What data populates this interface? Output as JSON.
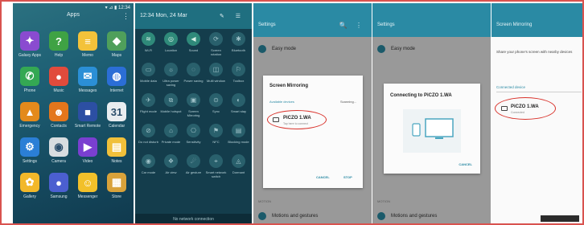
{
  "panel1": {
    "status_right": "▾ ⊿ ▮ 12:34",
    "title": "Apps",
    "more_icon": "⋮",
    "apps": [
      {
        "label": "Galaxy Apps",
        "color": "#8a4bd0",
        "glyph": "✦"
      },
      {
        "label": "Help",
        "color": "#3fa244",
        "glyph": "?"
      },
      {
        "label": "Memo",
        "color": "#f3c23a",
        "glyph": "≡"
      },
      {
        "label": "Maps",
        "color": "#4f9f5b",
        "glyph": "◆"
      },
      {
        "label": "Phone",
        "color": "#34a853",
        "glyph": "✆"
      },
      {
        "label": "Music",
        "color": "#e14b3c",
        "glyph": "●"
      },
      {
        "label": "Messages",
        "color": "#2b8fd6",
        "glyph": "✉"
      },
      {
        "label": "Internet",
        "color": "#2b6ed6",
        "glyph": "◍"
      },
      {
        "label": "Emergency",
        "color": "#e38a1c",
        "glyph": "▲"
      },
      {
        "label": "Contacts",
        "color": "#e3761c",
        "glyph": "☻"
      },
      {
        "label": "Smart Remote",
        "color": "#2c4fa3",
        "glyph": "■"
      },
      {
        "label": "Calendar",
        "color": "#e9edf0",
        "glyph": "31"
      },
      {
        "label": "Settings",
        "color": "#2b7fd6",
        "glyph": "⚙"
      },
      {
        "label": "Camera",
        "color": "#d8dde0",
        "glyph": "◉"
      },
      {
        "label": "Video",
        "color": "#7a3fd0",
        "glyph": "▶"
      },
      {
        "label": "Notes",
        "color": "#f0c03a",
        "glyph": "▤"
      },
      {
        "label": "Gallery",
        "color": "#f2b82a",
        "glyph": "✿"
      },
      {
        "label": "Samsung",
        "color": "#4b5fd0",
        "glyph": "●"
      },
      {
        "label": "Messenger",
        "color": "#f2c02a",
        "glyph": "☺"
      },
      {
        "label": "Store",
        "color": "#d9a23a",
        "glyph": "▦"
      }
    ]
  },
  "panel2": {
    "time": "12:34 Mon, 24 Mar",
    "header_icons": "✎ ☰",
    "tiles": [
      {
        "glyph": "≋",
        "label": "Wi-Fi",
        "on": true
      },
      {
        "glyph": "◎",
        "label": "Location",
        "on": true
      },
      {
        "glyph": "◀",
        "label": "Sound",
        "on": true
      },
      {
        "glyph": "⟳",
        "label": "Screen rotation",
        "on": false
      },
      {
        "glyph": "✱",
        "label": "Bluetooth",
        "on": false
      },
      {
        "glyph": "▭",
        "label": "Mobile data",
        "on": false
      },
      {
        "glyph": "☼",
        "label": "Ultra power saving",
        "on": false
      },
      {
        "glyph": "◌",
        "label": "Power saving",
        "on": false
      },
      {
        "glyph": "◫",
        "label": "Multi window",
        "on": false
      },
      {
        "glyph": "⚐",
        "label": "Toolbox",
        "on": false
      },
      {
        "glyph": "✈",
        "label": "Flight mode",
        "on": false
      },
      {
        "glyph": "⧉",
        "label": "Mobile hotspot",
        "on": false
      },
      {
        "glyph": "▣",
        "label": "Screen Mirroring",
        "on": false
      },
      {
        "glyph": "⊙",
        "label": "Sync",
        "on": false
      },
      {
        "glyph": "◐",
        "label": "Smart stay",
        "on": false
      },
      {
        "glyph": "⊘",
        "label": "Do not disturb",
        "on": false
      },
      {
        "glyph": "⌂",
        "label": "Private mode",
        "on": false
      },
      {
        "glyph": "⎔",
        "label": "Sensitivity",
        "on": false
      },
      {
        "glyph": "⚑",
        "label": "NFC",
        "on": false
      },
      {
        "glyph": "▤",
        "label": "Blocking mode",
        "on": false
      },
      {
        "glyph": "◉",
        "label": "Car mode",
        "on": false
      },
      {
        "glyph": "❖",
        "label": "Air view",
        "on": false
      },
      {
        "glyph": "☄",
        "label": "Air gesture",
        "on": false
      },
      {
        "glyph": "⌖",
        "label": "Smart network switch",
        "on": false
      },
      {
        "glyph": "◬",
        "label": "Dormant",
        "on": false
      }
    ],
    "footer": "No network connection"
  },
  "panel3": {
    "title": "Settings",
    "icons": "🔍 ⋮",
    "row_top": "Easy mode",
    "section": "MOTION",
    "row_bottom": "Motions and gestures",
    "dialog": {
      "title": "Screen Mirroring",
      "available": "Available devices",
      "scanning": "Scanning...",
      "device_name": "PiCZO 1.WA",
      "device_sub": "Tap here to connect",
      "cancel": "CANCEL",
      "stop": "STOP"
    }
  },
  "panel4": {
    "title": "Settings",
    "row_top": "Easy mode",
    "section": "MOTION",
    "row_bottom": "Motions and gestures",
    "dialog": {
      "title": "Connecting to PiCZO 1.WA",
      "cancel": "CANCEL"
    }
  },
  "panel5": {
    "title": "Screen Mirroring",
    "description": "Share your phone's screen with nearby devices",
    "section": "Connected device",
    "device_name": "PiCZO 1.WA",
    "device_sub": "Connected"
  }
}
